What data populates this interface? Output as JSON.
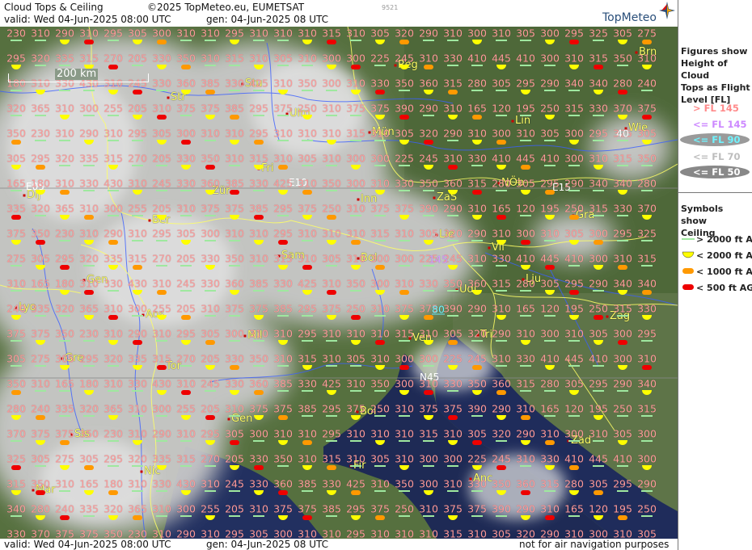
{
  "header": {
    "title": "Cloud Tops & Ceiling",
    "copyright": "©2025 TopMeteo.eu, EUMETSAT",
    "valid": "valid:  Wed  04-Jun-2025  08:00 UTC",
    "generated": "gen: 04-Jun-2025 08 UTC",
    "code": "9521",
    "logo": "TopMeteo"
  },
  "map": {
    "scale_label": "200 km",
    "grid_labels": [
      "E05",
      "E10",
      "E15",
      "N45"
    ],
    "cities": [
      "Brn",
      "Reg",
      "Stu",
      "Str",
      "Ulm",
      "Mün",
      "Lin",
      "Wie",
      "Fri",
      "Zür",
      "Dij",
      "Inn",
      "ZaS",
      "NÖb",
      "Gra",
      "Ber",
      "Lie",
      "Vil",
      "Sam",
      "Bol",
      "Gen",
      "Lju",
      "Udi",
      "Lyo",
      "Aos",
      "Mil",
      "Zag",
      "Ven",
      "Tri",
      "Gre",
      "Tor",
      "Gen",
      "Bol",
      "Sis",
      "Zad",
      "Fir",
      "Nic",
      "Mar",
      "Anc"
    ],
    "flight_levels": [
      "230",
      "310",
      "290",
      "310",
      "295",
      "305",
      "300",
      "310",
      "310",
      "295",
      "310",
      "310",
      "310",
      "315",
      "310",
      "305",
      "320",
      "290",
      "310",
      "300",
      "310",
      "305",
      "300",
      "295",
      "325",
      "305",
      "275",
      "305",
      "295",
      "320",
      "335",
      "315",
      "270",
      "205",
      "330",
      "350",
      "310",
      "315",
      "310",
      "305",
      "310",
      "300",
      "300",
      "225",
      "245",
      "310",
      "330",
      "410",
      "445",
      "410",
      "300",
      "310",
      "315",
      "350",
      "310",
      "165",
      "180",
      "310",
      "330",
      "430",
      "310",
      "245",
      "330",
      "360",
      "385",
      "330",
      "425",
      "310",
      "350",
      "300",
      "310",
      "330",
      "350",
      "360",
      "315",
      "280",
      "305",
      "295",
      "290",
      "340",
      "340",
      "280",
      "240",
      "335",
      "320",
      "365",
      "310",
      "300",
      "255",
      "205",
      "310",
      "375",
      "375",
      "385",
      "295",
      "375",
      "250",
      "310",
      "375",
      "375",
      "390",
      "290",
      "310",
      "165",
      "120",
      "195",
      "250",
      "315",
      "330",
      "370",
      "375",
      "375",
      "350"
    ],
    "low_labels": [
      "80"
    ],
    "mid_labels": [
      "145"
    ],
    "low_cloud_label": "40"
  },
  "footer": {
    "valid": "valid:  Wed  04-Jun-2025  08:00 UTC",
    "generated": "gen: 04-Jun-2025 08 UTC",
    "disclaimer": "not for air navigation purposes"
  },
  "legend": {
    "figures_title": "Figures show\nHeight of Cloud\nTops as Flight\nLevel  [FL]",
    "fl_items": [
      {
        "label": "> FL 145",
        "color": "#ff8a8a"
      },
      {
        "label": "<= FL 145",
        "color": "#cc88ff"
      },
      {
        "label": "<= FL 90",
        "color": "#6ff4ff"
      },
      {
        "label": "<= FL 70",
        "color": "#e8e8e8"
      },
      {
        "label": "<= FL 50",
        "color": "#ffffff"
      }
    ],
    "symbols_title": "Symbols show\nCeiling",
    "symbol_items": [
      {
        "label": "> 2000 ft AGL",
        "color": "#9fe89f"
      },
      {
        "label": "< 2000 ft AGL",
        "color": "#ffff00"
      },
      {
        "label": "< 1000 ft AGL",
        "color": "#ff9900"
      },
      {
        "label": "< 500 ft AGL",
        "color": "#ee0000"
      }
    ]
  }
}
